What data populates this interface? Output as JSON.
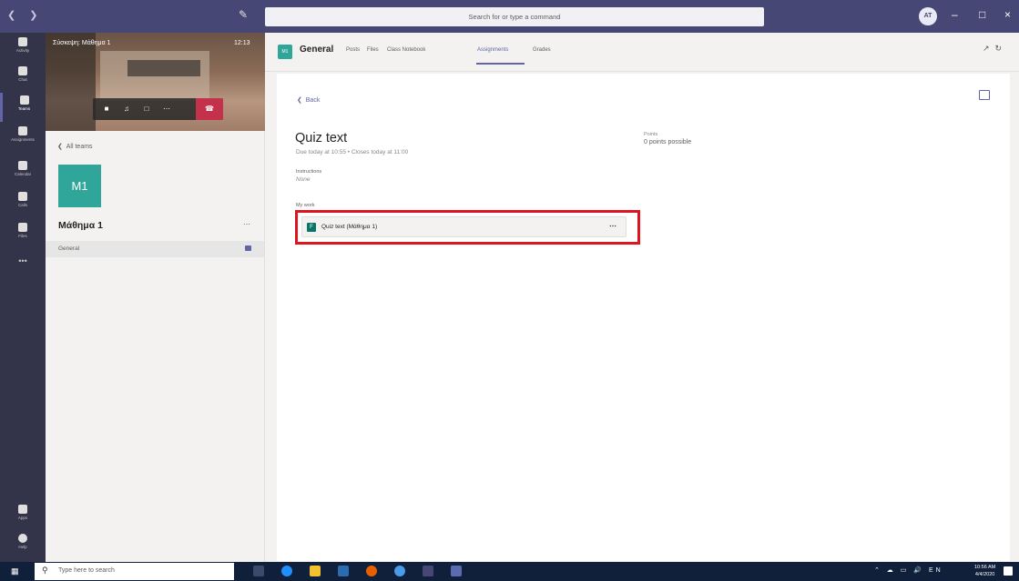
{
  "titlebar": {
    "search_placeholder": "Search for or type a command",
    "avatar_initials": "AT"
  },
  "rail": {
    "items": [
      {
        "label": "Activity",
        "icon": "bell-icon"
      },
      {
        "label": "Chat",
        "icon": "chat-icon"
      },
      {
        "label": "Teams",
        "icon": "teams-icon"
      },
      {
        "label": "Assignments",
        "icon": "assignments-icon"
      },
      {
        "label": "Calendar",
        "icon": "calendar-icon"
      },
      {
        "label": "Calls",
        "icon": "phone-icon"
      },
      {
        "label": "Files",
        "icon": "file-icon"
      }
    ],
    "apps_label": "Apps",
    "help_label": "Help"
  },
  "video": {
    "title": "Σύσκεψη: Μάθημα 1",
    "time": "12:13"
  },
  "teams_panel": {
    "all_teams": "All teams",
    "team_initials": "M1",
    "team_name": "Μάθημα 1",
    "channel": "General"
  },
  "header": {
    "badge": "M1",
    "channel_title": "General",
    "tabs": [
      "Posts",
      "Files",
      "Class Notebook",
      "Assignments",
      "Grades"
    ],
    "active_tab": "Assignments"
  },
  "assignment": {
    "back": "Back",
    "title": "Quiz text",
    "due": "Due today at 10:55  •  Closes today at 11:00",
    "points_label": "Points",
    "points_value": "0 points possible",
    "instructions_label": "Instructions",
    "instructions_value": "None",
    "my_work_label": "My work",
    "work_item": "Quiz text (Μάθημα 1)"
  },
  "taskbar": {
    "search_placeholder": "Type here to search",
    "time": "10:56 AM",
    "date": "4/4/2020",
    "lang": "EN"
  },
  "colors": {
    "accent": "#6264a7",
    "titlebar": "#464775",
    "rail": "#33344a",
    "team_tile": "#30a59a",
    "highlight": "#e0141e",
    "hangup": "#c4314b",
    "taskbar": "#101f3a"
  }
}
